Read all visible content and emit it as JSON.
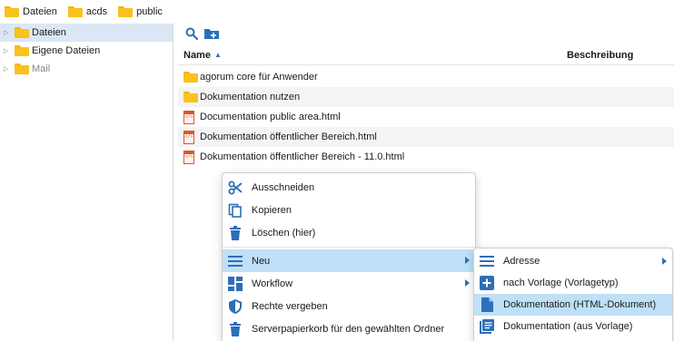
{
  "breadcrumb": [
    {
      "label": "Dateien"
    },
    {
      "label": "acds"
    },
    {
      "label": "public"
    }
  ],
  "tree": {
    "items": [
      {
        "label": "Dateien",
        "icon": "folder-icon"
      },
      {
        "label": "Eigene Dateien",
        "icon": "folder-icon"
      },
      {
        "label": "Mail",
        "icon": "folder-icon"
      }
    ]
  },
  "toolbar": {
    "search_icon": "search-icon",
    "new_folder_icon": "new-folder-icon"
  },
  "columns": {
    "name": "Name",
    "description": "Beschreibung"
  },
  "files": [
    {
      "name": "agorum core für Anwender",
      "type": "folder"
    },
    {
      "name": "Dokumentation nutzen",
      "type": "folder"
    },
    {
      "name": "Documentation public area.html",
      "type": "html"
    },
    {
      "name": "Dokumentation öffentlicher Bereich.html",
      "type": "html"
    },
    {
      "name": "Dokumentation öffentlicher Bereich - 11.0.html",
      "type": "html"
    }
  ],
  "context_menu": {
    "items": [
      {
        "label": "Ausschneiden",
        "icon": "scissors-icon"
      },
      {
        "label": "Kopieren",
        "icon": "copy-icon"
      },
      {
        "label": "Löschen (hier)",
        "icon": "trash-icon"
      },
      {
        "label": "Neu",
        "icon": "menu-lines-icon"
      },
      {
        "label": "Workflow",
        "icon": "workflow-icon"
      },
      {
        "label": "Rechte vergeben",
        "icon": "shield-icon"
      },
      {
        "label": "Serverpapierkorb für den gewählten Ordner",
        "icon": "trash-icon"
      }
    ]
  },
  "submenu": {
    "items": [
      {
        "label": "Adresse",
        "icon": "menu-lines-icon"
      },
      {
        "label": "nach Vorlage (Vorlagetyp)",
        "icon": "plus-box-icon"
      },
      {
        "label": "Dokumentation (HTML-Dokument)",
        "icon": "document-icon"
      },
      {
        "label": "Dokumentation (aus Vorlage)",
        "icon": "document-list-icon"
      }
    ]
  },
  "colors": {
    "accent": "#2d6fb7",
    "selection": "#dbe7f4",
    "menu_highlight": "#bfe0f7",
    "folder": "#f9c21c"
  }
}
